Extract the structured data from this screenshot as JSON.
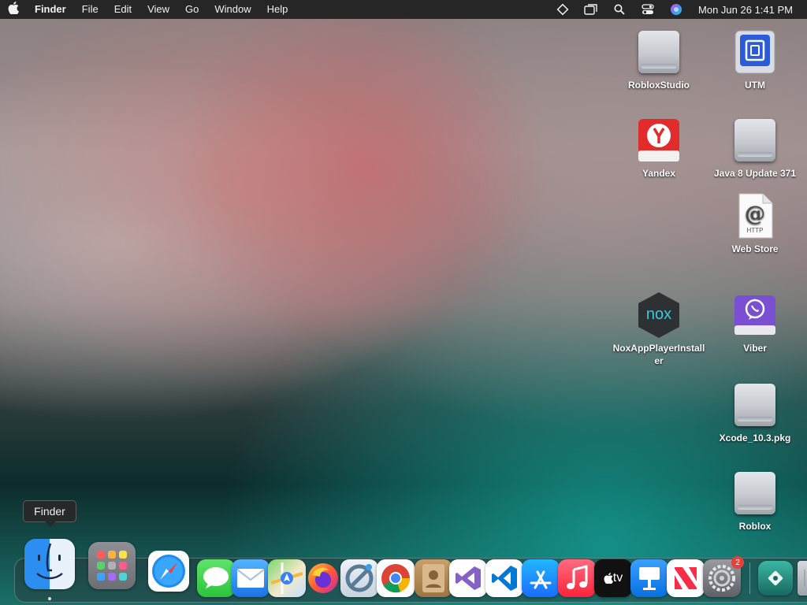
{
  "menubar": {
    "apple_icon": "apple-icon",
    "app_name": "Finder",
    "menus": [
      "File",
      "Edit",
      "View",
      "Go",
      "Window",
      "Help"
    ],
    "status_icons": [
      "diamond-icon",
      "window-icon",
      "search-icon",
      "control-center-icon",
      "siri-icon"
    ],
    "clock": "Mon Jun 26  1:41 PM"
  },
  "desktop": {
    "items": [
      {
        "label": "RobloxStudio",
        "icon": "disk-image-icon"
      },
      {
        "label": "UTM",
        "icon": "utm-app-icon"
      },
      {
        "label": "Yandex",
        "icon": "yandex-app-icon"
      },
      {
        "label": "Java 8 Update 371",
        "icon": "disk-image-icon"
      },
      {
        "label": "Web Store",
        "icon": "webloc-document-icon",
        "badge_text": "HTTP"
      },
      {
        "label": "NoxAppPlayerInstaller",
        "icon": "nox-app-icon",
        "logo_text": "nox"
      },
      {
        "label": "Viber",
        "icon": "viber-disk-icon"
      },
      {
        "label": "Xcode_10.3.pkg",
        "icon": "disk-image-icon"
      },
      {
        "label": "Roblox",
        "icon": "disk-image-icon"
      }
    ]
  },
  "tooltip": {
    "text": "Finder"
  },
  "dock": {
    "apps": [
      {
        "name": "Finder",
        "icon": "finder-icon"
      },
      {
        "name": "Launchpad",
        "icon": "launchpad-icon"
      },
      {
        "name": "Safari",
        "icon": "safari-icon"
      },
      {
        "name": "Messages",
        "icon": "messages-icon"
      },
      {
        "name": "Mail",
        "icon": "mail-icon"
      },
      {
        "name": "Maps",
        "icon": "maps-icon"
      },
      {
        "name": "Firefox",
        "icon": "firefox-icon"
      },
      {
        "name": "Compressor",
        "icon": "no-sign-icon"
      },
      {
        "name": "Chrome",
        "icon": "chrome-icon"
      },
      {
        "name": "Contacts",
        "icon": "contacts-icon"
      },
      {
        "name": "Visual Studio",
        "icon": "visual-studio-icon"
      },
      {
        "name": "VS Code",
        "icon": "vscode-icon"
      },
      {
        "name": "App Store",
        "icon": "app-store-icon"
      },
      {
        "name": "Music",
        "icon": "music-icon"
      },
      {
        "name": "TV",
        "icon": "apple-tv-icon",
        "label_text": "tv"
      },
      {
        "name": "Keynote",
        "icon": "keynote-icon"
      },
      {
        "name": "News",
        "icon": "news-icon"
      },
      {
        "name": "System Settings",
        "icon": "system-settings-icon",
        "badge": "2"
      },
      {
        "name": "Downloads stack",
        "icon": "stack-icon"
      },
      {
        "name": "Trash",
        "icon": "trash-icon"
      }
    ]
  },
  "colors": {
    "menubar_bg": "#1e1e1e",
    "badge_red": "#e5413a",
    "dock_bg": "#28323780"
  }
}
